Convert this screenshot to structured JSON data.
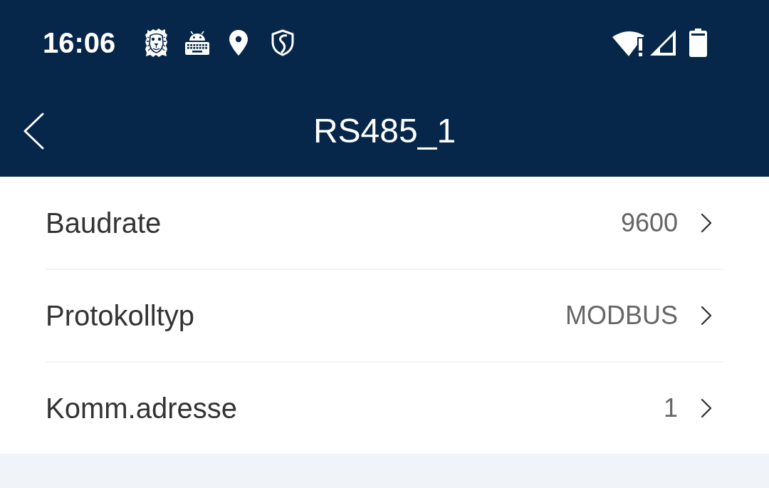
{
  "status_bar": {
    "time": "16:06"
  },
  "header": {
    "title": "RS485_1"
  },
  "settings": [
    {
      "label": "Baudrate",
      "value": "9600"
    },
    {
      "label": "Protokolltyp",
      "value": "MODBUS"
    },
    {
      "label": "Komm.adresse",
      "value": "1"
    }
  ]
}
